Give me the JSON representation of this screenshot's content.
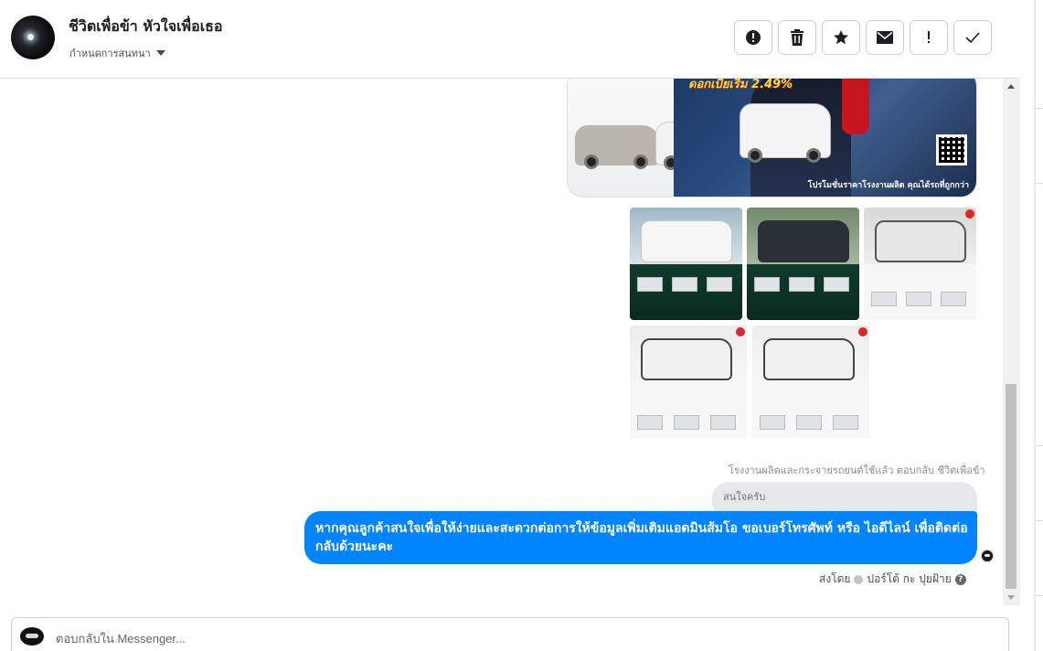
{
  "conversation": {
    "title": "ชีวิตเพื่อข้า หัวใจเพื่อเธอ",
    "assign_label": "กำหนดการสนทนา"
  },
  "toolbar": [
    {
      "name": "mark-spam-button",
      "icon": "alert-circle-icon"
    },
    {
      "name": "delete-button",
      "icon": "trash-icon"
    },
    {
      "name": "star-button",
      "icon": "star-icon"
    },
    {
      "name": "mark-unread-button",
      "icon": "envelope-icon"
    },
    {
      "name": "follow-up-button",
      "icon": "exclamation-icon"
    },
    {
      "name": "mark-done-button",
      "icon": "checkmark-icon"
    }
  ],
  "banner": {
    "promo_text": "ดอกเบี้ยเริ่ม 2.49%",
    "caption": "โปรโมชั่นราคาโรงงานผลิต คุณได้รถที่ถูกกว่า"
  },
  "thumbnails": [
    {
      "id": "thumb-1",
      "theme": "light"
    },
    {
      "id": "thumb-2",
      "theme": "dark"
    },
    {
      "id": "thumb-3",
      "theme": "light"
    },
    {
      "id": "thumb-4",
      "theme": "light"
    },
    {
      "id": "thumb-5",
      "theme": "light"
    }
  ],
  "reply": {
    "note": "โรงงานผลิตและกระจายรถยนต์ใช้แล้ว ตอบกลับ ชีวิตเพื่อข้า",
    "quoted_text": "สนใจครับ"
  },
  "message": {
    "text": "หากคุณลูกค้าสนใจเพื่อให้ง่ายและสะดวกต่อการให้ข้อมูลเพิ่มเติมแอดมินส้มโอ ขอเบอร์โทรศัพท์ หรือ ไอดีไลน์ เพื่อติดต่อกลับด้วยนะคะ",
    "sent_by_label": "ส่งโดย",
    "sender_name": "ปอร์โต้ กะ ปุยฝ้าย"
  },
  "composer": {
    "placeholder": "ตอบกลับใน Messenger..."
  },
  "colors": {
    "accent": "#0084ff",
    "bubble_quote": "#e4e6eb"
  }
}
